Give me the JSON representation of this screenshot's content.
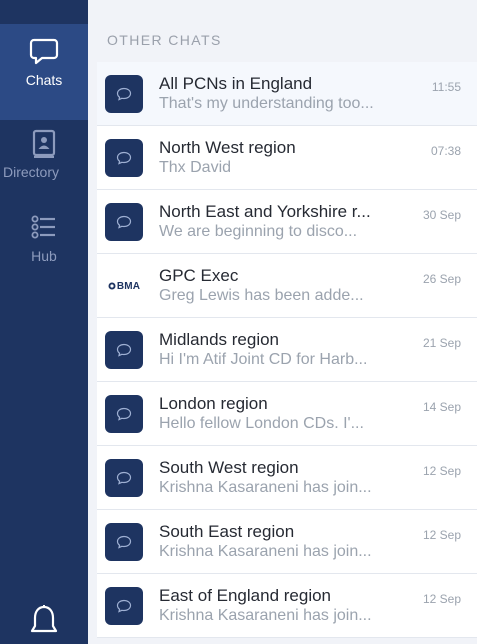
{
  "sidebar": {
    "items": [
      {
        "label": "Chats",
        "icon": "chat-bubble-icon",
        "active": true
      },
      {
        "label": "Directory",
        "icon": "directory-icon",
        "active": false
      },
      {
        "label": "Hub",
        "icon": "list-icon",
        "active": false
      }
    ],
    "bottom_icon": "bell-icon"
  },
  "main": {
    "section_title": "OTHER CHATS",
    "chats": [
      {
        "title": "All PCNs in England",
        "preview": "That's my understanding too...",
        "time": "11:55",
        "avatar": "chat-bubble-icon"
      },
      {
        "title": "North West region",
        "preview": "Thx David",
        "time": "07:38",
        "avatar": "chat-bubble-icon"
      },
      {
        "title": "North East and Yorkshire r...",
        "preview": "We are beginning to disco...",
        "time": "30 Sep",
        "avatar": "chat-bubble-icon"
      },
      {
        "title": "GPC Exec",
        "preview": "Greg Lewis has been adde...",
        "time": "26 Sep",
        "avatar": "bma-logo",
        "avatar_text": "BMA"
      },
      {
        "title": "Midlands region",
        "preview": "Hi I'm Atif Joint CD for Harb...",
        "time": "21 Sep",
        "avatar": "chat-bubble-icon"
      },
      {
        "title": "London region",
        "preview": "Hello fellow London CDs. I'...",
        "time": "14 Sep",
        "avatar": "chat-bubble-icon"
      },
      {
        "title": "South West region",
        "preview": "Krishna Kasaraneni has join...",
        "time": "12 Sep",
        "avatar": "chat-bubble-icon"
      },
      {
        "title": "South East region",
        "preview": "Krishna Kasaraneni has join...",
        "time": "12 Sep",
        "avatar": "chat-bubble-icon"
      },
      {
        "title": "East of England region",
        "preview": "Krishna Kasaraneni has join...",
        "time": "12 Sep",
        "avatar": "chat-bubble-icon"
      }
    ]
  },
  "colors": {
    "sidebar_bg": "#1e3461",
    "sidebar_active": "#2c4a85",
    "avatar_bg": "#1e3461",
    "muted_text": "#9ba3ae"
  }
}
